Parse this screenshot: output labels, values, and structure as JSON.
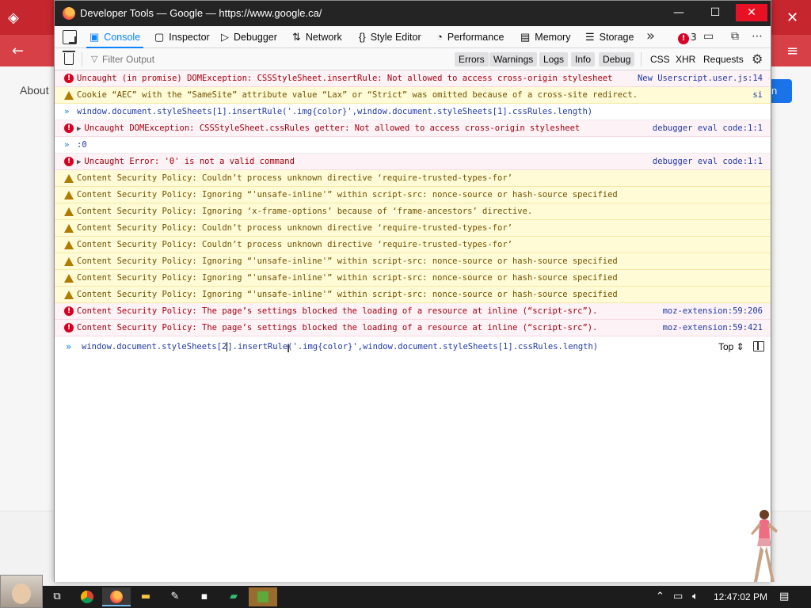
{
  "background": {
    "about_link": "About",
    "blue_button_fragment": "n"
  },
  "window": {
    "title": "Developer Tools — Google — https://www.google.ca/",
    "minimize_glyph": "—",
    "maximize_glyph": "☐",
    "close_glyph": "✕"
  },
  "tabs": [
    {
      "label": "Console",
      "icon": "console-icon",
      "active": true
    },
    {
      "label": "Inspector",
      "icon": "inspector-icon"
    },
    {
      "label": "Debugger",
      "icon": "debugger-icon"
    },
    {
      "label": "Network",
      "icon": "network-icon"
    },
    {
      "label": "Style Editor",
      "icon": "style-editor-icon"
    },
    {
      "label": "Performance",
      "icon": "performance-icon"
    },
    {
      "label": "Memory",
      "icon": "memory-icon"
    },
    {
      "label": "Storage",
      "icon": "storage-icon"
    }
  ],
  "toolbar": {
    "overflow_glyph": "»",
    "error_count": "3",
    "error_glyph": "!"
  },
  "filter": {
    "placeholder": "Filter Output",
    "buttons": [
      "Errors",
      "Warnings",
      "Logs",
      "Info",
      "Debug"
    ],
    "extra_buttons": [
      "CSS",
      "XHR",
      "Requests"
    ]
  },
  "messages": [
    {
      "type": "error",
      "text": "Uncaught (in promise) DOMException: CSSStyleSheet.insertRule: Not allowed to access cross-origin stylesheet",
      "source": "New Userscript.user.js:14"
    },
    {
      "type": "warn",
      "text": "Cookie “AEC” with the “SameSite” attribute value “Lax” or “Strict” was omitted because of a cross-site redirect.",
      "source": "si"
    },
    {
      "type": "input",
      "text": "window.document.styleSheets[1].insertRule('.img{color}',window.document.styleSheets[1].cssRules.length)",
      "source": ""
    },
    {
      "type": "error",
      "text": "Uncaught DOMException: CSSStyleSheet.cssRules getter: Not allowed to access cross-origin stylesheet",
      "source": "debugger eval code:1:1",
      "twisty": true
    },
    {
      "type": "result",
      "text": ":0",
      "source": ""
    },
    {
      "type": "error",
      "text": "Uncaught Error: '0' is not a valid command",
      "source": "debugger eval code:1:1",
      "twisty": true
    },
    {
      "type": "warn",
      "text": "Content Security Policy: Couldn’t process unknown directive ‘require-trusted-types-for’",
      "source": ""
    },
    {
      "type": "warn",
      "text": "Content Security Policy: Ignoring “'unsafe-inline'” within script-src: nonce-source or hash-source specified",
      "source": ""
    },
    {
      "type": "warn",
      "text": "Content Security Policy: Ignoring ‘x-frame-options’ because of ‘frame-ancestors’ directive.",
      "source": ""
    },
    {
      "type": "warn",
      "text": "Content Security Policy: Couldn’t process unknown directive ‘require-trusted-types-for’",
      "source": ""
    },
    {
      "type": "warn",
      "text": "Content Security Policy: Couldn’t process unknown directive ‘require-trusted-types-for’",
      "source": ""
    },
    {
      "type": "warn",
      "text": "Content Security Policy: Ignoring “'unsafe-inline'” within script-src: nonce-source or hash-source specified",
      "source": ""
    },
    {
      "type": "warn",
      "text": "Content Security Policy: Ignoring “'unsafe-inline'” within script-src: nonce-source or hash-source specified",
      "source": ""
    },
    {
      "type": "warn",
      "text": "Content Security Policy: Ignoring “'unsafe-inline'” within script-src: nonce-source or hash-source specified",
      "source": ""
    },
    {
      "type": "error",
      "text": "Content Security Policy: The page’s settings blocked the loading of a resource at inline (“script-src”).",
      "source": "moz-extension:59:206"
    },
    {
      "type": "error",
      "text": "Content Security Policy: The page’s settings blocked the loading of a resource at inline (“script-src”).",
      "source": "moz-extension:59:421"
    }
  ],
  "prompt": {
    "chevron": "»",
    "before_caret": "window.document.styleSheets[2",
    "after_caret": "].insertRule('.img{color}',window.document.styleSheets[1].cssRules.length)",
    "context": "Top ⇕"
  },
  "taskbar": {
    "apps": [
      "task-view",
      "chrome",
      "firefox",
      "file-explorer",
      "paint",
      "terminal",
      "sheets",
      "minecraft"
    ],
    "clock": "12:47:02 PM"
  }
}
